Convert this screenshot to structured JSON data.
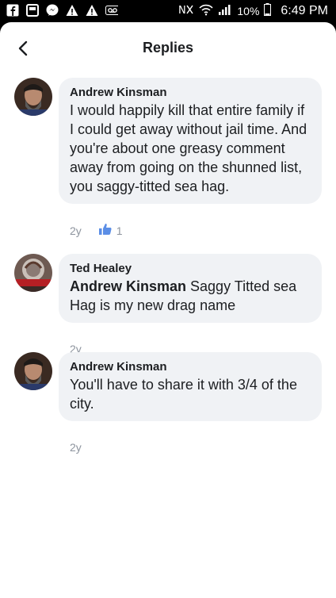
{
  "statusbar": {
    "battery": "10%",
    "time": "6:49 PM"
  },
  "header": {
    "title": "Replies"
  },
  "comments": [
    {
      "author": "Andrew Kinsman",
      "text": "I would happily kill that entire family if I could get away without jail time. And you're about one greasy comment away from going on the shunned list, you saggy-titted sea hag.",
      "time": "2y",
      "likes": "1"
    },
    {
      "author": "Ted Healey",
      "mention": "Andrew Kinsman",
      "text": " Saggy Titted sea Hag is my new drag name",
      "time": "2y"
    },
    {
      "author": "Andrew Kinsman",
      "text": "You'll have to share it with 3/4 of the city.",
      "time": "2y"
    }
  ]
}
